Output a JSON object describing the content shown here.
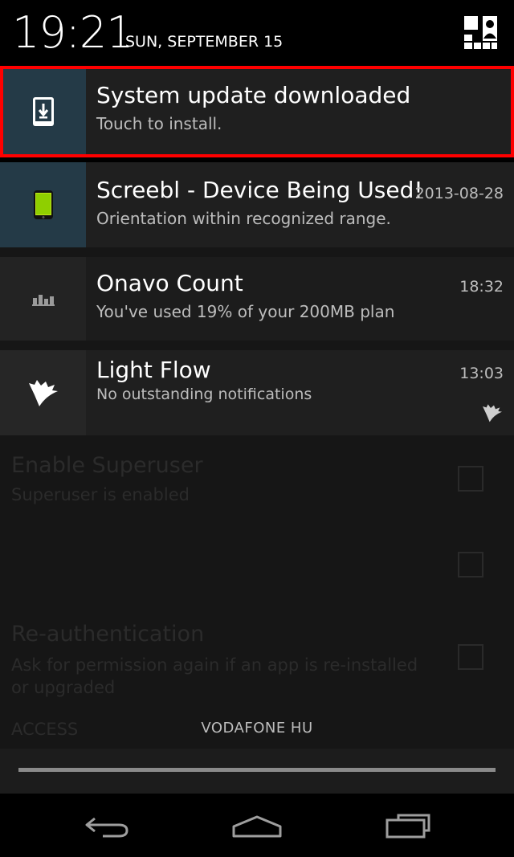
{
  "status": {
    "time": "19:21",
    "date": "SUN, SEPTEMBER 15",
    "quick_settings_icon": "user-grid-icon"
  },
  "notifications": [
    {
      "app_icon": "download-phone-icon",
      "title": "System update downloaded",
      "subtitle": "Touch to install.",
      "time": "",
      "highlighted": true
    },
    {
      "app_icon": "green-phone-icon",
      "title": "Screebl - Device Being Used!",
      "subtitle": "Orientation within recognized range.",
      "time": "2013-08-28"
    },
    {
      "app_icon": "bar-chart-icon",
      "title": "Onavo Count",
      "subtitle": "You've used 19% of your 200MB plan",
      "time": "18:32"
    },
    {
      "app_icon": "light-flow-icon",
      "title": "Light Flow",
      "subtitle": "No outstanding notifications",
      "time": "13:03"
    }
  ],
  "background_app": {
    "items": [
      {
        "title": "Enable Superuser",
        "subtitle": "Superuser is enabled"
      },
      {
        "title": "Re-authentication",
        "subtitle": "Ask for permission again if an app is re-installed or upgraded"
      }
    ],
    "section": "ACCESS"
  },
  "carrier": "VODAFONE HU",
  "navbar": {
    "back_icon": "back-icon",
    "home_icon": "home-icon",
    "recents_icon": "recents-icon"
  },
  "colors": {
    "highlight": "#ff0000",
    "icon_tile": "#243a47",
    "notification_bg": "#1f1f1f"
  }
}
